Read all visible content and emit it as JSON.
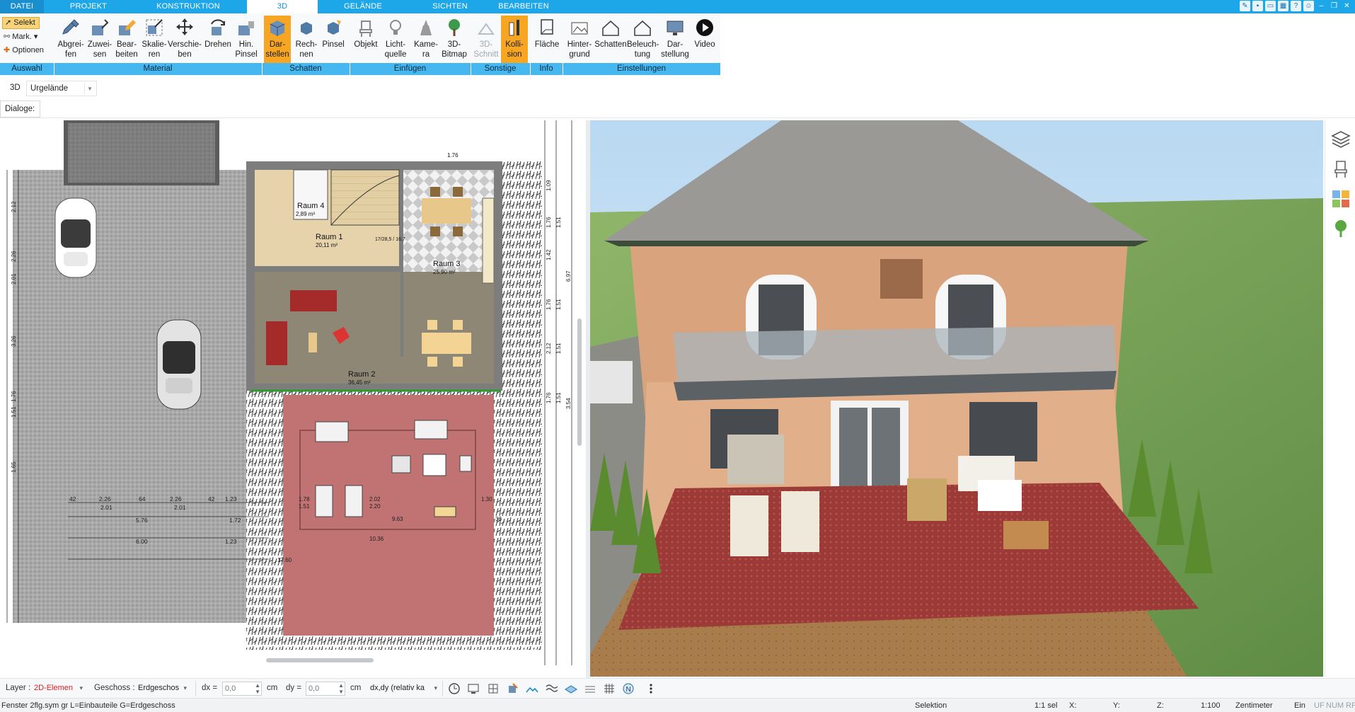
{
  "tabs": {
    "datei": "DATEI",
    "projekt": "PROJEKT",
    "konstruktion": "KONSTRUKTION",
    "d3": "3D",
    "gelaende": "GELÄNDE",
    "sichten": "SICHTEN",
    "bearbeiten": "BEARBEITEN"
  },
  "ribbon": {
    "selection": {
      "select": "Selekt",
      "mark": "Mark.",
      "options": "Optionen"
    },
    "buttons": {
      "abgreifen": [
        "Abgrei-",
        "fen"
      ],
      "zuweisen": [
        "Zuwei-",
        "sen"
      ],
      "bearbeiten": [
        "Bear-",
        "beiten"
      ],
      "skalieren": [
        "Skalie-",
        "ren"
      ],
      "verschieben": [
        "Verschie-",
        "ben"
      ],
      "drehen": [
        "Drehen",
        ""
      ],
      "hinpinsel": [
        "Hin.",
        "Pinsel"
      ],
      "darstellen": [
        "Dar-",
        "stellen"
      ],
      "rechnen": [
        "Rech-",
        "nen"
      ],
      "pinsel": [
        "Pinsel",
        ""
      ],
      "objekt": [
        "Objekt",
        ""
      ],
      "lichtquelle": [
        "Licht-",
        "quelle"
      ],
      "kamera": [
        "Kame-",
        "ra"
      ],
      "bitmap": [
        "3D-",
        "Bitmap"
      ],
      "schnitt": [
        "3D-",
        "Schnitt"
      ],
      "kollision": [
        "Kolli-",
        "sion"
      ],
      "flaeche": [
        "Fläche",
        ""
      ],
      "hintergrund": [
        "Hinter-",
        "grund"
      ],
      "schatten": [
        "Schatten",
        ""
      ],
      "beleuchtung": [
        "Beleuch-",
        "tung"
      ],
      "darstellung": [
        "Dar-",
        "stellung"
      ],
      "video": [
        "Video",
        ""
      ]
    },
    "groups": {
      "auswahl": "Auswahl",
      "material": "Material",
      "schatten": "Schatten",
      "einfuegen": "Einfügen",
      "sonstige": "Sonstige",
      "info": "Info",
      "einstellungen": "Einstellungen"
    }
  },
  "subbar": {
    "mode": "3D",
    "terrain": "Urgelände",
    "dialoge": "Dialoge:"
  },
  "plan": {
    "rooms": [
      {
        "name": "Raum 4",
        "area": "2,89 m²"
      },
      {
        "name": "Raum 1",
        "area": "20,11 m²"
      },
      {
        "name": "Raum 3",
        "area": "25,90 m²"
      },
      {
        "name": "Raum 2",
        "area": "36,45 m²"
      }
    ],
    "dims_left": [
      "2.12",
      "2.26",
      "2.01",
      "3.26",
      "1.76",
      "1.51",
      "1.65"
    ],
    "dims_right": [
      "1.09",
      "1.76",
      "1.51",
      "1.42",
      "6.97",
      "1.76",
      "1.51",
      "2.12",
      "1.51",
      "1.76",
      "1.51",
      "3.54"
    ],
    "dims_bottom_1": [
      "42",
      "2.26",
      "64",
      "2.26",
      "42",
      "1.23"
    ],
    "dims_bottom_2": [
      "2.01",
      "2.01"
    ],
    "dims_bottom_3": [
      "5.76",
      "1.72"
    ],
    "dims_bottom_4": [
      "6.00",
      "1.23"
    ],
    "dims_terrace": [
      "1.78",
      "1.51",
      "2.02",
      "2.20",
      "1.30",
      "9.63",
      "10.36",
      "17.60",
      "36"
    ],
    "stairs": "17/28,5 / 16,7",
    "top_dim": "1.76"
  },
  "toolbar": {
    "layer_label": "Layer :",
    "layer_value": "2D-Elemen",
    "geschoss_label": "Geschoss :",
    "geschoss_value": "Erdgeschos",
    "dx_label": "dx =",
    "dx_value": "0,0",
    "dx_unit": "cm",
    "dy_label": "dy =",
    "dy_value": "0,0",
    "dy_unit": "cm",
    "mode_value": "dx,dy (relativ ka"
  },
  "status": {
    "left": "Fenster 2flg.sym gr L=Einbauteile G=Erdgeschoss",
    "selektion": "Selektion",
    "sel": "1:1 sel",
    "x": "X:",
    "y": "Y:",
    "z": "Z:",
    "scale": "1:100",
    "unit": "Zentimeter",
    "ein": "Ein",
    "uf": "UF",
    "num": "NUM",
    "rf": "RF"
  },
  "colors": {
    "tabbar": "#1ea7e8",
    "group_label": "#47b7ef",
    "active_button": "#f6a623",
    "layer_red": "#e02020"
  }
}
